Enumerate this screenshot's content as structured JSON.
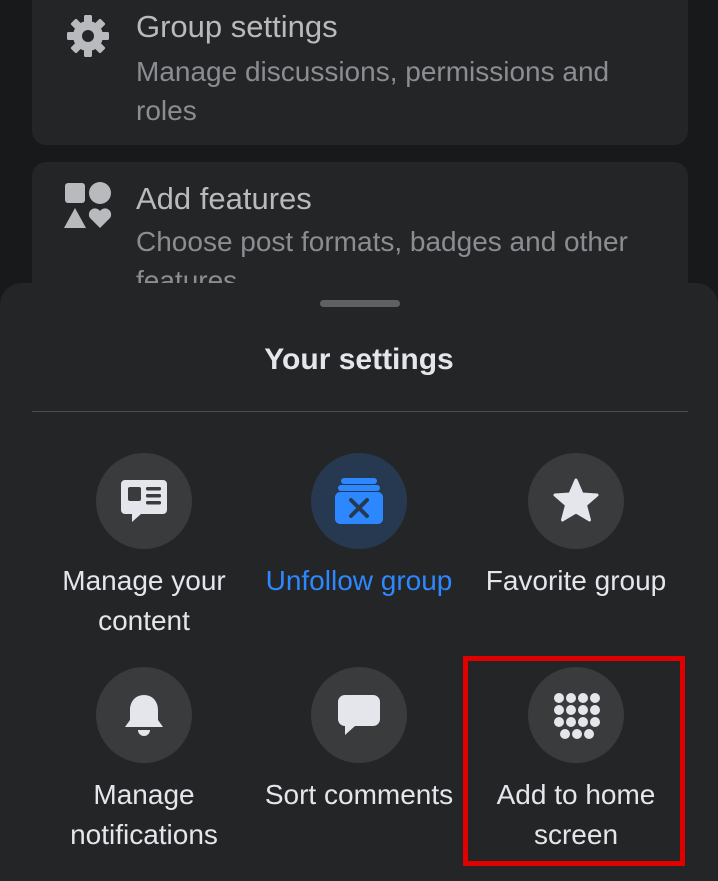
{
  "background_list": {
    "group_settings": {
      "title": "Group settings",
      "description": "Manage discussions, permissions and roles",
      "icon": "gear-icon"
    },
    "add_features": {
      "title": "Add features",
      "description": "Choose post formats, badges and other features",
      "icon": "shapes-icon"
    }
  },
  "sheet": {
    "title": "Your settings",
    "options": [
      {
        "label": "Manage your content",
        "icon": "content-icon"
      },
      {
        "label": "Unfollow group",
        "icon": "unfollow-icon",
        "active": true
      },
      {
        "label": "Favorite group",
        "icon": "star-icon"
      },
      {
        "label": "Manage notifications",
        "icon": "bell-icon"
      },
      {
        "label": "Sort comments",
        "icon": "comment-icon"
      },
      {
        "label": "Add to home screen",
        "icon": "grid-dots-icon"
      }
    ]
  },
  "colors": {
    "accent": "#2d88ff",
    "highlight": "#e00000",
    "sheet_bg": "#242526",
    "circle_bg": "#3a3b3c"
  }
}
